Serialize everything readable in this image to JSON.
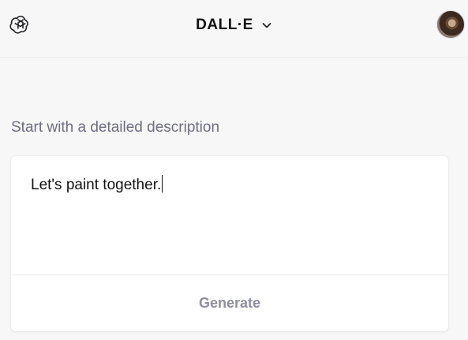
{
  "header": {
    "logo_icon": "openai-logo-icon",
    "title": "DALL·E",
    "dropdown_icon": "chevron-down-icon",
    "avatar_icon": "user-avatar"
  },
  "prompt": {
    "label": "Start with a detailed description",
    "value": "Let's paint together.",
    "generate_label": "Generate"
  },
  "colors": {
    "background": "#f7f7f8",
    "card": "#ffffff",
    "label_text": "#6e6e80",
    "disabled_button_text": "#8e8ea0"
  }
}
